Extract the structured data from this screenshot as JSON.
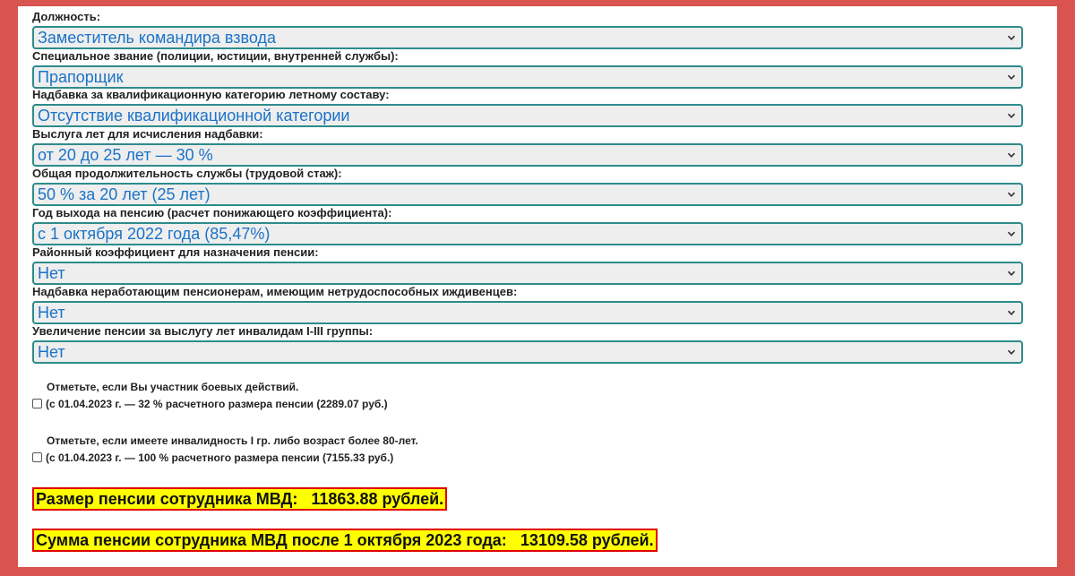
{
  "fields": [
    {
      "label": "Должность:",
      "value": "Заместитель командира взвода"
    },
    {
      "label": "Специальное звание (полиции, юстиции, внутренней службы):",
      "value": "Прапорщик"
    },
    {
      "label": "Надбавка за квалификационную категорию летному составу:",
      "value": "Отсутствие квалификационной категории"
    },
    {
      "label": "Выслуга лет для исчисления надбавки:",
      "value": "от 20 до 25 лет — 30 %"
    },
    {
      "label": "Общая продолжительность службы (трудовой стаж):",
      "value": "50 % за 20 лет (25 лет)"
    },
    {
      "label": "Год выхода на пенсию (расчет понижающего коэффициента):",
      "value": "с 1 октября 2022 года (85,47%)"
    },
    {
      "label": "Районный коэффициент для назначения пенсии:",
      "value": "Нет"
    },
    {
      "label": "Надбавка неработающим пенсионерам, имеющим нетрудоспособных иждивенцев:",
      "value": "Нет"
    },
    {
      "label": "Увеличение пенсии за выслугу лет инвалидам I-III группы:",
      "value": "Нет"
    }
  ],
  "checks": [
    {
      "title": "Отметьте, если Вы участник боевых действий.",
      "note": "(с 01.04.2023 г. — 32 % расчетного размера пенсии (2289.07 руб.)",
      "checked": false
    },
    {
      "title": "Отметьте, если имеете инвалидность I гр. либо возраст более 80-лет.",
      "note": "(с 01.04.2023 г. — 100 % расчетного размера пенсии (7155.33 руб.)",
      "checked": false
    }
  ],
  "results": {
    "pension_label": "Размер пенсии сотрудника МВД:",
    "pension_value": "11863.88 рублей.",
    "after_label": "Сумма пенсии сотрудника МВД после 1 октября 2023 года:",
    "after_value": "13109.58 рублей."
  },
  "colors": {
    "frame": "#d9534f",
    "select_border": "#2e8b8b",
    "select_text": "#1a73c8",
    "result_bg": "#ffff00",
    "result_border": "#e00000"
  },
  "icons": {
    "dropdown": "chevron-down-icon"
  }
}
